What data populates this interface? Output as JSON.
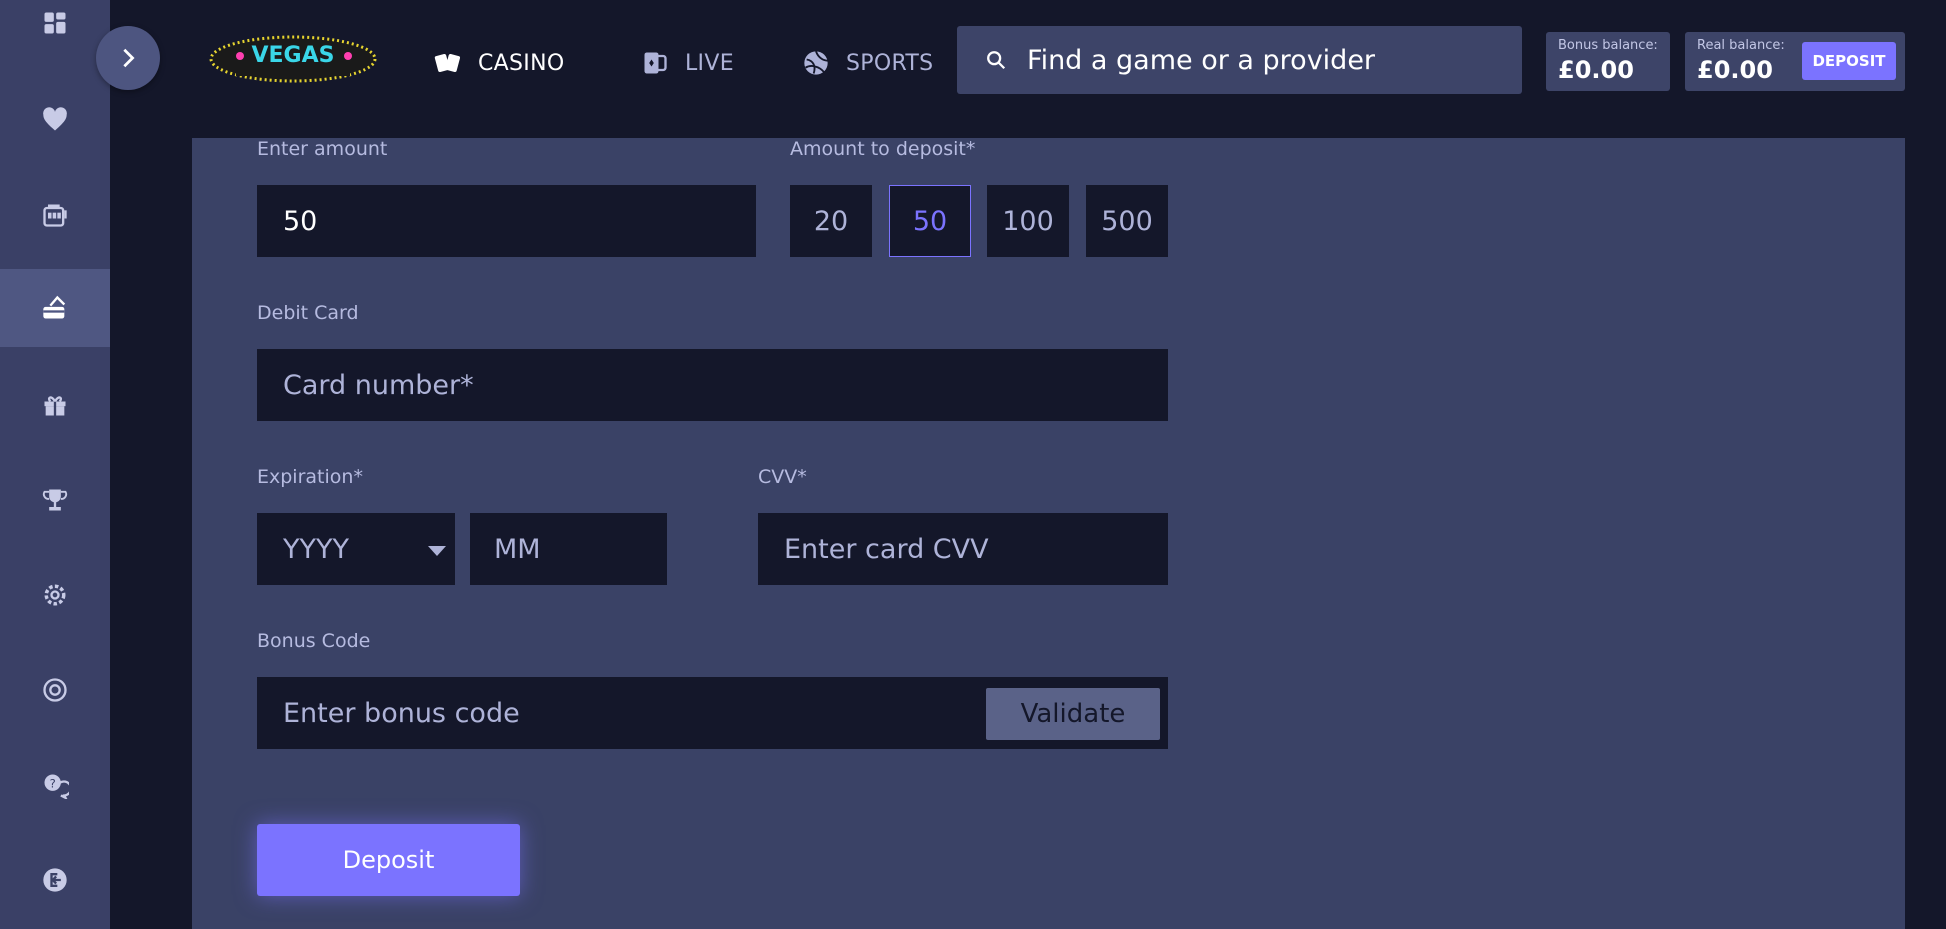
{
  "header": {
    "nav": [
      {
        "label": "CASINO",
        "icon": "cards-icon"
      },
      {
        "label": "LIVE",
        "icon": "live-cards-icon"
      },
      {
        "label": "SPORTS",
        "icon": "ball-icon"
      }
    ],
    "search_placeholder": "Find a game or a provider",
    "bonus_balance": {
      "label": "Bonus balance:",
      "value": "£0.00"
    },
    "real_balance": {
      "label": "Real balance:",
      "value": "£0.00"
    },
    "deposit_label": "DEPOSIT"
  },
  "sidebar": {
    "items": [
      {
        "icon": "grid-icon"
      },
      {
        "icon": "heart-icon"
      },
      {
        "icon": "slot-machine-icon"
      },
      {
        "icon": "cashier-icon",
        "active": true
      },
      {
        "icon": "gift-icon"
      },
      {
        "icon": "trophy-icon"
      },
      {
        "icon": "settings-icon"
      },
      {
        "icon": "support-icon"
      },
      {
        "icon": "help-chat-icon"
      },
      {
        "icon": "logout-icon"
      }
    ]
  },
  "form": {
    "enter_amount_label": "Enter amount",
    "amount_value": "50",
    "amount_to_deposit_label": "Amount to deposit*",
    "amounts": [
      "20",
      "50",
      "100",
      "500"
    ],
    "selected_amount": "50",
    "debit_card_label": "Debit Card",
    "card_number_placeholder": "Card number*",
    "expiration_label": "Expiration*",
    "year_placeholder": "YYYY",
    "month_placeholder": "MM",
    "cvv_label": "CVV*",
    "cvv_placeholder": "Enter card CVV",
    "bonus_code_label": "Bonus Code",
    "bonus_code_placeholder": "Enter bonus code",
    "validate_label": "Validate",
    "deposit_label": "Deposit"
  },
  "colors": {
    "accent": "#7b73ff",
    "panel": "#3a4266",
    "input_bg": "#14172a"
  }
}
